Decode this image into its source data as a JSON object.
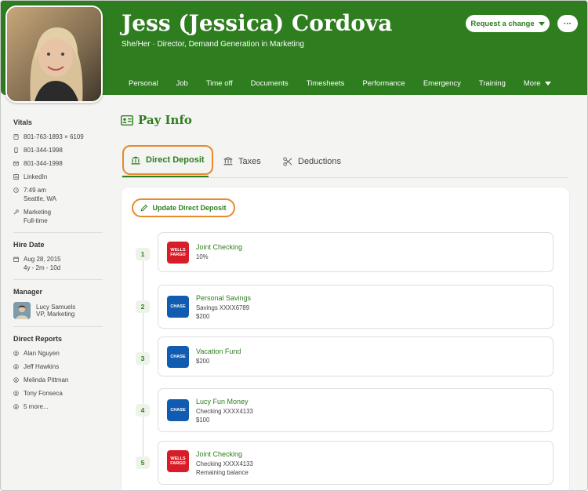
{
  "profile": {
    "name": "Jess (Jessica) Cordova",
    "subtitle": "She/Her · Director, Demand Generation in Marketing",
    "request_change_label": "Request a change",
    "more_actions_label": "···"
  },
  "nav_tabs": [
    {
      "label": "Personal"
    },
    {
      "label": "Job"
    },
    {
      "label": "Time off"
    },
    {
      "label": "Documents"
    },
    {
      "label": "Timesheets"
    },
    {
      "label": "Performance"
    },
    {
      "label": "Emergency"
    },
    {
      "label": "Training"
    },
    {
      "label": "More"
    }
  ],
  "sidebar": {
    "vitals_heading": "Vitals",
    "vitals": {
      "work_phone": "801-763-1893 × 6109",
      "mobile_phone": "801-344-1998",
      "email": "801-344-1998",
      "linkedin": "LinkedIn",
      "local_time": "7:49 am",
      "location": "Seattle, WA",
      "department": "Marketing",
      "employment_type": "Full-time"
    },
    "hire_date_heading": "Hire Date",
    "hire_date": "Aug 28, 2015",
    "tenure": "4y - 2m - 10d",
    "manager_heading": "Manager",
    "manager_name": "Lucy Samuels",
    "manager_title": "VP, Marketing",
    "direct_reports_heading": "Direct Reports",
    "direct_reports": [
      "Alan Nguyen",
      "Jeff Hawkins",
      "Melinda Pittman",
      "Tony Fonseca",
      "5 more..."
    ]
  },
  "pay_info": {
    "title": "Pay Info",
    "subtabs": [
      "Direct Deposit",
      "Taxes",
      "Deductions"
    ],
    "update_button_label": "Update Direct Deposit",
    "deposits": [
      {
        "step": "1",
        "bank_logo": "WELLS FARGO",
        "account_name": "Joint Checking",
        "details": [
          "10%"
        ]
      },
      {
        "step": "2",
        "bank_logo": "CHASE",
        "account_name": "Personal Savings",
        "details": [
          "Savings XXXX6789",
          "$200"
        ]
      },
      {
        "step": "3",
        "bank_logo": "CHASE",
        "account_name": "Vacation Fund",
        "details": [
          "$200"
        ]
      },
      {
        "step": "4",
        "bank_logo": "CHASE",
        "account_name": "Lucy Fun Money",
        "details": [
          "Checking XXXX4133",
          "$100"
        ]
      },
      {
        "step": "5",
        "bank_logo": "WELLS FARGO",
        "account_name": "Joint Checking",
        "details": [
          "Checking XXXX4133",
          "Remaining balance"
        ]
      }
    ]
  },
  "colors": {
    "brand_green": "#2e7d1f",
    "highlight_orange": "#e8892c",
    "wells_fargo_red": "#d71e28",
    "chase_blue": "#115cb0"
  }
}
